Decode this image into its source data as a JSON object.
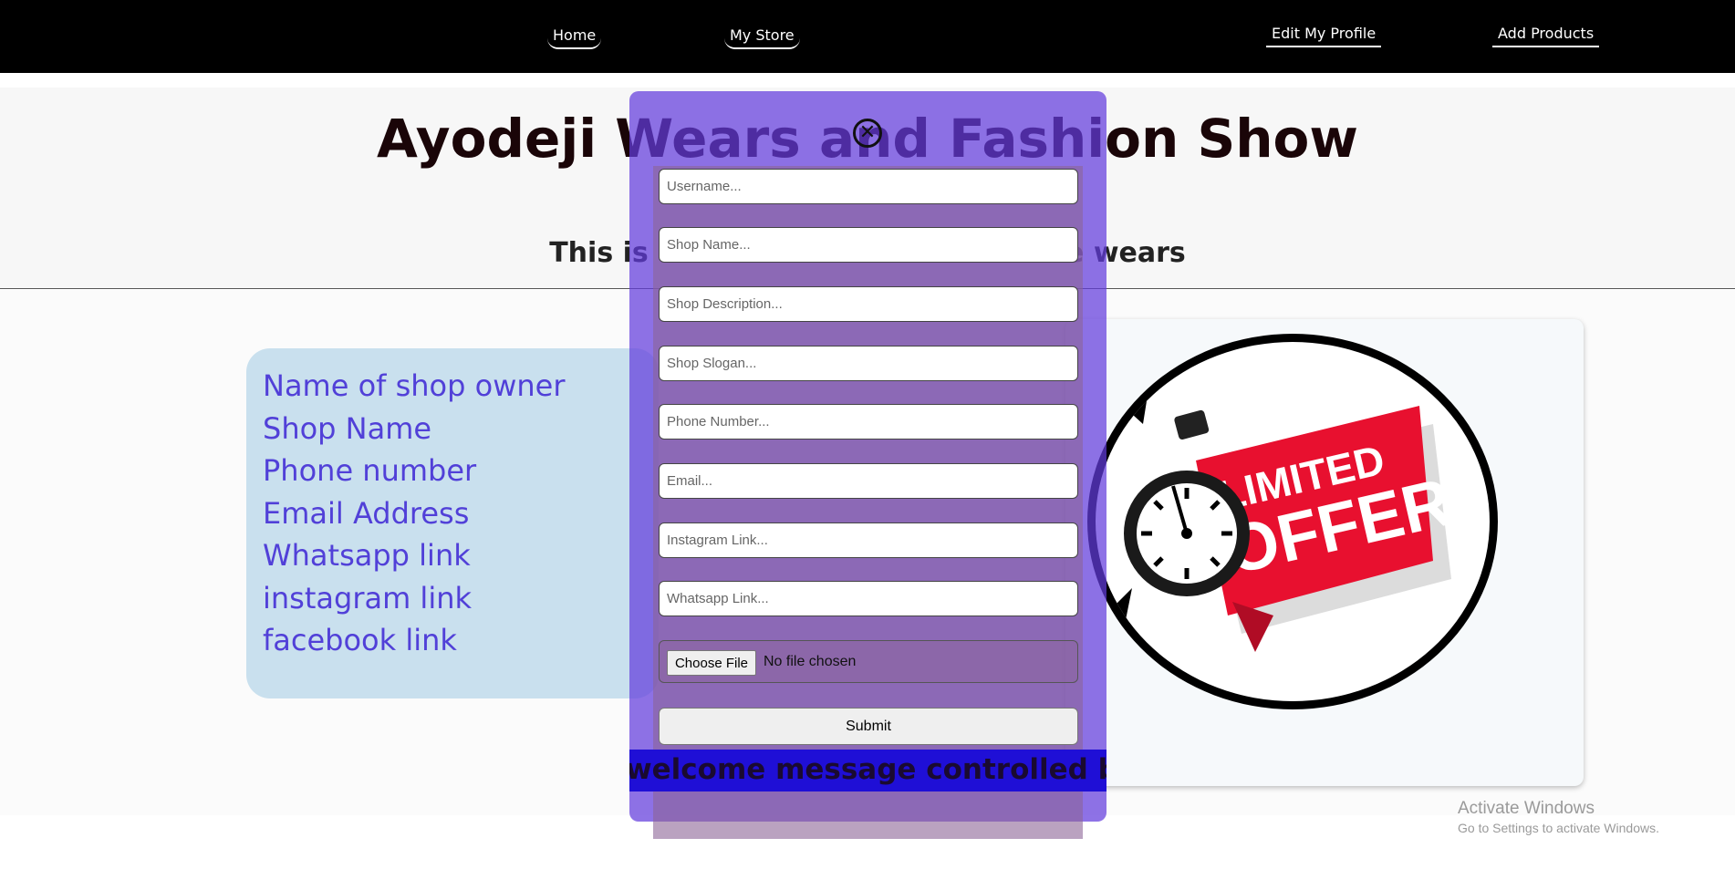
{
  "nav": {
    "home": "Home",
    "my_store": "My Store",
    "edit_profile": "Edit My Profile",
    "add_products": "Add Products"
  },
  "hero": {
    "title": "Ayodeji Wears and Fashion Show",
    "subtitle": "This is a fashion e... made to taste wears"
  },
  "info": {
    "lines": [
      "Name of shop owner",
      "Shop Name",
      "Phone number",
      "Email Address",
      "Whatsapp link",
      "instagram link",
      "facebook link"
    ]
  },
  "image": {
    "text_line1": "LIMITED",
    "text_line2": "OFFER"
  },
  "modal": {
    "close_symbol": "✕",
    "fields": {
      "username": "Username...",
      "shop_name": "Shop Name...",
      "shop_description": "Shop Description...",
      "shop_slogan": "Shop Slogan...",
      "phone": "Phone Number...",
      "email": "Email...",
      "instagram": "Instagram Link...",
      "whatsapp": "Whatsapp Link..."
    },
    "file_button": "Choose File",
    "file_status": "No file chosen",
    "submit": "Submit",
    "banner": "welcome message controlled by Api"
  },
  "windows": {
    "line1": "Activate Windows",
    "line2": "Go to Settings to activate Windows."
  },
  "colors": {
    "nav_bg": "#000000",
    "info_text": "#5140d8",
    "info_bg": "#c9e0ee",
    "modal_bg": "#633cdc",
    "banner_bg": "#1f0fd6",
    "offer_red": "#e8102f"
  }
}
